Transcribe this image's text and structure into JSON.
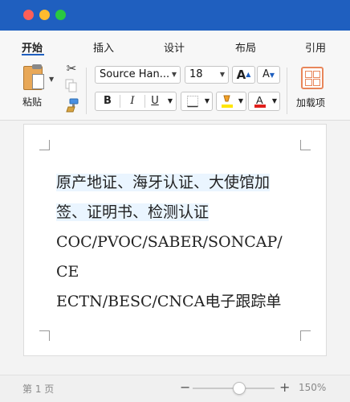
{
  "tabs": [
    {
      "label": "开始"
    },
    {
      "label": "插入"
    },
    {
      "label": "设计"
    },
    {
      "label": "布局"
    },
    {
      "label": "引用"
    }
  ],
  "active_tab": "开始",
  "clipboard": {
    "paste_label": "粘贴",
    "paste_icon": "clipboard-icon",
    "cut_icon": "scissors-icon",
    "copy_icon": "copy-icon",
    "format_painter_icon": "paintbrush-icon"
  },
  "font": {
    "family": "Source Han...",
    "size": "18",
    "grow_label": "A",
    "shrink_label": "A",
    "bold_label": "B",
    "italic_label": "I",
    "underline_label": "U",
    "highlight_color": "#ffe600",
    "font_color": "#e0201c"
  },
  "addins": {
    "label": "加载项",
    "icon": "grid-icon",
    "accent": "#e8865a"
  },
  "document": {
    "paragraph": [
      {
        "text": "原产地证、海牙认证、大使馆加",
        "highlight": true
      },
      {
        "text": "签、证明书、检测认证",
        "highlight": true
      },
      {
        "text": "COC/PVOC/SABER/SONCAP/",
        "highlight": false
      },
      {
        "text": "CE",
        "highlight": false
      },
      {
        "text": "ECTN/BESC/CNCA电子跟踪单",
        "highlight": false
      }
    ]
  },
  "status": {
    "page": "第 1 页",
    "zoom_minus": "−",
    "zoom_plus": "+",
    "zoom": "150%",
    "zoom_fraction": 0.5
  },
  "colors": {
    "titlebar": "#1f5fbf",
    "accent": "#1f5fbf"
  }
}
